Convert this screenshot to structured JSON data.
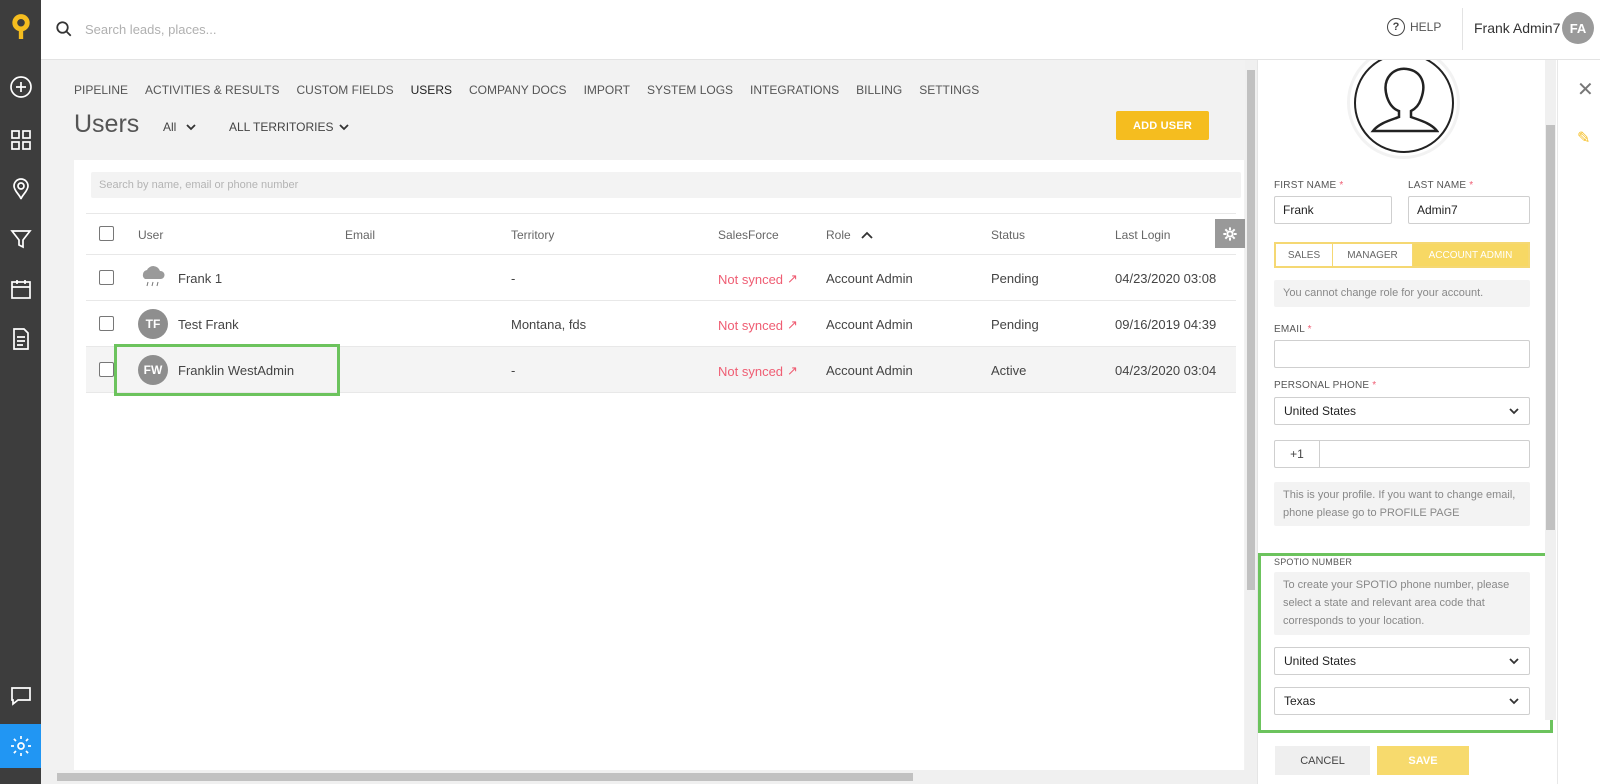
{
  "search": {
    "placeholder": "Search leads, places..."
  },
  "header": {
    "help_label": "HELP",
    "user_name": "Frank Admin7",
    "user_initials": "FA"
  },
  "nav": {
    "tabs": [
      "PIPELINE",
      "ACTIVITIES & RESULTS",
      "CUSTOM FIELDS",
      "USERS",
      "COMPANY DOCS",
      "IMPORT",
      "SYSTEM LOGS",
      "INTEGRATIONS",
      "BILLING",
      "SETTINGS"
    ],
    "current": "USERS"
  },
  "page": {
    "title": "Users",
    "filter_all": "All",
    "filter_territories": "ALL TERRITORIES",
    "add_user_label": "ADD USER"
  },
  "table": {
    "search_placeholder": "Search by name, email or phone number",
    "columns": {
      "user": "User",
      "email": "Email",
      "territory": "Territory",
      "salesforce": "SalesForce",
      "role": "Role",
      "status": "Status",
      "last_login": "Last Login"
    },
    "rows": [
      {
        "initials": "",
        "name": "Frank 1",
        "email": "",
        "territory": "-",
        "salesforce": "Not synced",
        "role": "Account Admin",
        "status": "Pending",
        "last_login": "04/23/2020 03:08"
      },
      {
        "initials": "TF",
        "name": "Test Frank",
        "email": "",
        "territory": "Montana, fds",
        "salesforce": "Not synced",
        "role": "Account Admin",
        "status": "Pending",
        "last_login": "09/16/2019 04:39"
      },
      {
        "initials": "FW",
        "name": "Franklin WestAdmin",
        "email": "",
        "territory": "-",
        "salesforce": "Not synced",
        "role": "Account Admin",
        "status": "Active",
        "last_login": "04/23/2020 03:04"
      }
    ]
  },
  "profile": {
    "first_name_label": "FIRST NAME",
    "last_name_label": "LAST NAME",
    "first_name": "Frank",
    "last_name": "Admin7",
    "roles": [
      "SALES",
      "MANAGER",
      "ACCOUNT ADMIN"
    ],
    "selected_role": "ACCOUNT ADMIN",
    "role_note": "You cannot change role for your account.",
    "email_label": "EMAIL",
    "email": "",
    "phone_label": "PERSONAL PHONE",
    "phone_country": "United States",
    "phone_prefix": "+1",
    "phone": "",
    "profile_note": "This is your profile. If you want to change email, phone please go to PROFILE PAGE",
    "spotio_label": "SPOTIO NUMBER",
    "spotio_note": "To create your SPOTIO phone number, please select a state and relevant area code that corresponds to your location.",
    "spotio_country": "United States",
    "spotio_state": "Texas",
    "cancel_label": "CANCEL",
    "save_label": "SAVE"
  },
  "colors": {
    "accent": "#f5bd1f",
    "not_synced": "#ef5d73",
    "highlight": "#6cc35d",
    "rail": "#3d3d3d",
    "active_rail": "#2196f3"
  }
}
